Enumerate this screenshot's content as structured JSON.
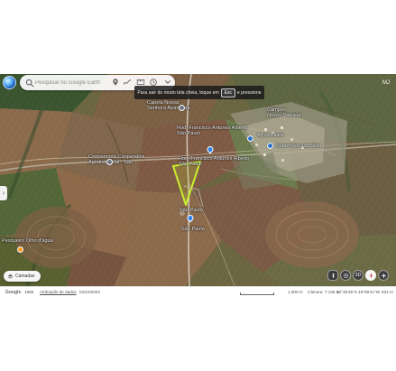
{
  "search": {
    "placeholder": "Pesquisar no Google Earth"
  },
  "top": {
    "profile_label": "MJ",
    "fullscreen_before": "Para sair do modo tela cheia, toque em",
    "fullscreen_key": "Esc",
    "fullscreen_after": "e pressione"
  },
  "labels": {
    "capela": "Capela Nossa\nSenhora Aparecida",
    "road_top": "Rod. Francisco Antunes Alberto\nSão Paulo",
    "camposnovos": "Campos\nNovos Paulista",
    "agropecuaria": "Agropecuária",
    "supermercado": "Supermercado Silva",
    "cooperativa": "Coopermota Cooperativa\nAgroindustrial - São",
    "road_mid": "Rod. Francisco Antunes Alberto\nSão Paulo",
    "sao_paulo_1": "São Paulo",
    "sao_paulo_2": "São Paulo",
    "pesqueiro": "Pesqueiro Olho d'água"
  },
  "buttons": {
    "layers": "Camadas",
    "ctrl_3d": "3D"
  },
  "status": {
    "google": "Google",
    "year": "1985",
    "attribution": "Atribuição de dados",
    "date": "04/10/2023",
    "scale": "1.000 m",
    "camera": "Câmera: 7.135 m",
    "coordinates": "22°35'35\"S 49°59'41\"W",
    "elevation": "534 m"
  },
  "colors": {
    "polygon": "#c9ef2f",
    "accent": "#2e73c9"
  }
}
